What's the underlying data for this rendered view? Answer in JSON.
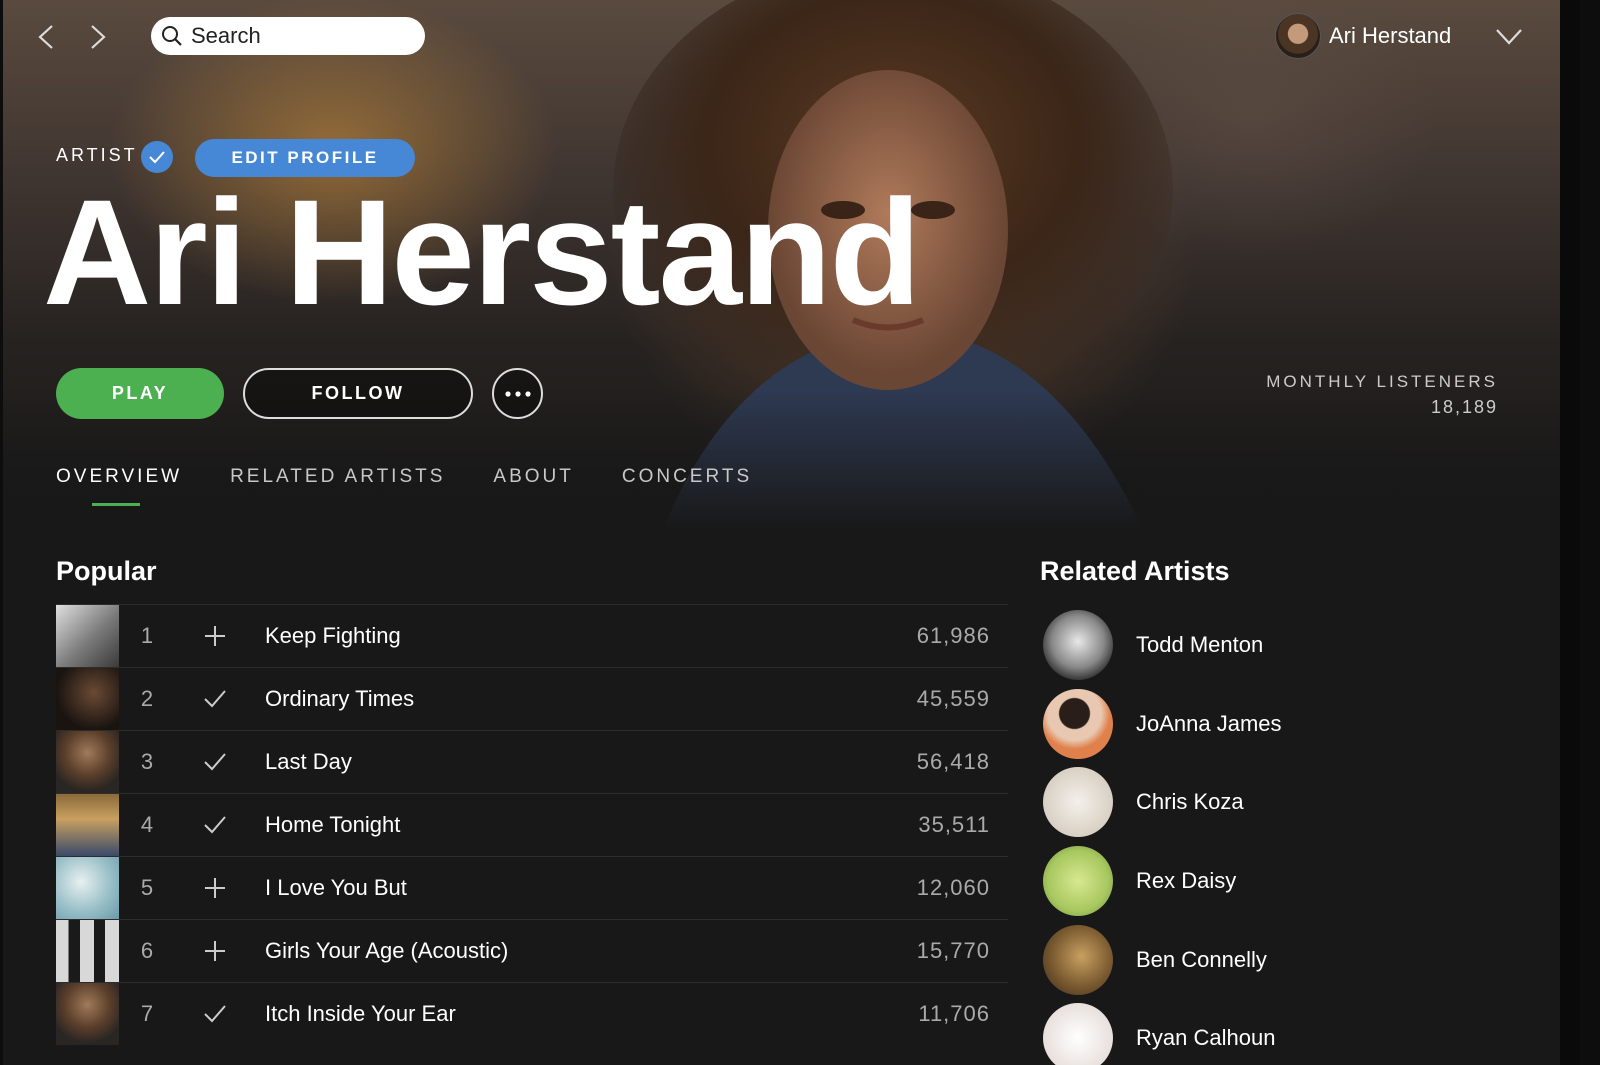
{
  "search": {
    "placeholder": "Search"
  },
  "user": {
    "name": "Ari Herstand"
  },
  "artist": {
    "type_label": "ARTIST",
    "edit_profile_label": "EDIT PROFILE",
    "name": "Ari Herstand",
    "verified": true
  },
  "actions": {
    "play_label": "PLAY",
    "follow_label": "FOLLOW"
  },
  "listeners": {
    "label": "MONTHLY LISTENERS",
    "value": "18,189"
  },
  "tabs": [
    {
      "label": "OVERVIEW",
      "active": true
    },
    {
      "label": "RELATED ARTISTS",
      "active": false
    },
    {
      "label": "ABOUT",
      "active": false
    },
    {
      "label": "CONCERTS",
      "active": false
    }
  ],
  "popular": {
    "title": "Popular",
    "tracks": [
      {
        "num": "1",
        "added": false,
        "title": "Keep Fighting",
        "plays": "61,986"
      },
      {
        "num": "2",
        "added": true,
        "title": "Ordinary Times",
        "plays": "45,559"
      },
      {
        "num": "3",
        "added": true,
        "title": "Last Day",
        "plays": "56,418"
      },
      {
        "num": "4",
        "added": true,
        "title": "Home Tonight",
        "plays": "35,511"
      },
      {
        "num": "5",
        "added": false,
        "title": "I Love You But",
        "plays": "12,060"
      },
      {
        "num": "6",
        "added": false,
        "title": "Girls Your Age (Acoustic)",
        "plays": "15,770"
      },
      {
        "num": "7",
        "added": true,
        "title": "Itch Inside Your Ear",
        "plays": "11,706"
      }
    ]
  },
  "related": {
    "title": "Related Artists",
    "artists": [
      {
        "name": "Todd Menton"
      },
      {
        "name": "JoAnna James"
      },
      {
        "name": "Chris Koza"
      },
      {
        "name": "Rex Daisy"
      },
      {
        "name": "Ben Connelly"
      },
      {
        "name": "Ryan Calhoun"
      }
    ]
  },
  "colors": {
    "accent_green": "#4caf50",
    "accent_blue": "#4687d6",
    "background": "#181818"
  }
}
